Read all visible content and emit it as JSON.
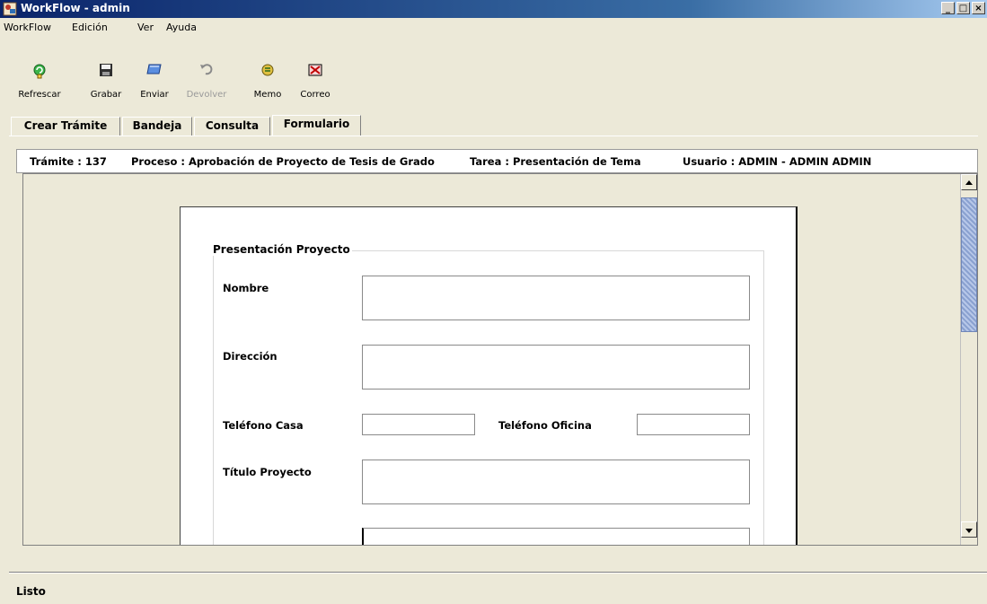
{
  "window": {
    "title": "WorkFlow - admin",
    "minimize": "_",
    "maximize": "□",
    "close": "×"
  },
  "menu": [
    "WorkFlow",
    "Edición",
    "Ver",
    "Ayuda"
  ],
  "toolbar": [
    {
      "label": "Refrescar",
      "icon": "refresh-icon",
      "enabled": true
    },
    {
      "label": "Grabar",
      "icon": "save-icon",
      "enabled": true
    },
    {
      "label": "Enviar",
      "icon": "send-icon",
      "enabled": true
    },
    {
      "label": "Devolver",
      "icon": "undo-icon",
      "enabled": false
    },
    {
      "label": "Memo",
      "icon": "memo-icon",
      "enabled": true
    },
    {
      "label": "Correo",
      "icon": "mail-icon",
      "enabled": true
    }
  ],
  "tabs": [
    "Crear Trámite",
    "Bandeja",
    "Consulta",
    "Formulario"
  ],
  "info": {
    "tramite": "Trámite : 137",
    "proceso": "Proceso : Aprobación de Proyecto de Tesis de Grado",
    "tarea": "Tarea : Presentación de Tema",
    "usuario": "Usuario : ADMIN - ADMIN ADMIN"
  },
  "form": {
    "group_title": "Presentación Proyecto",
    "nombre_label": "Nombre",
    "nombre_value": "",
    "direccion_label": "Dirección",
    "direccion_value": "",
    "telefono_casa_label": "Teléfono Casa",
    "telefono_casa_value": "",
    "telefono_oficina_label": "Teléfono Oficina",
    "telefono_oficina_value": "",
    "titulo_label": "Título Proyecto",
    "titulo_value": ""
  },
  "status": "Listo",
  "colors": {
    "title_bar": "#0a246a",
    "background": "#ece9d8",
    "form_background": "#ffffff"
  }
}
